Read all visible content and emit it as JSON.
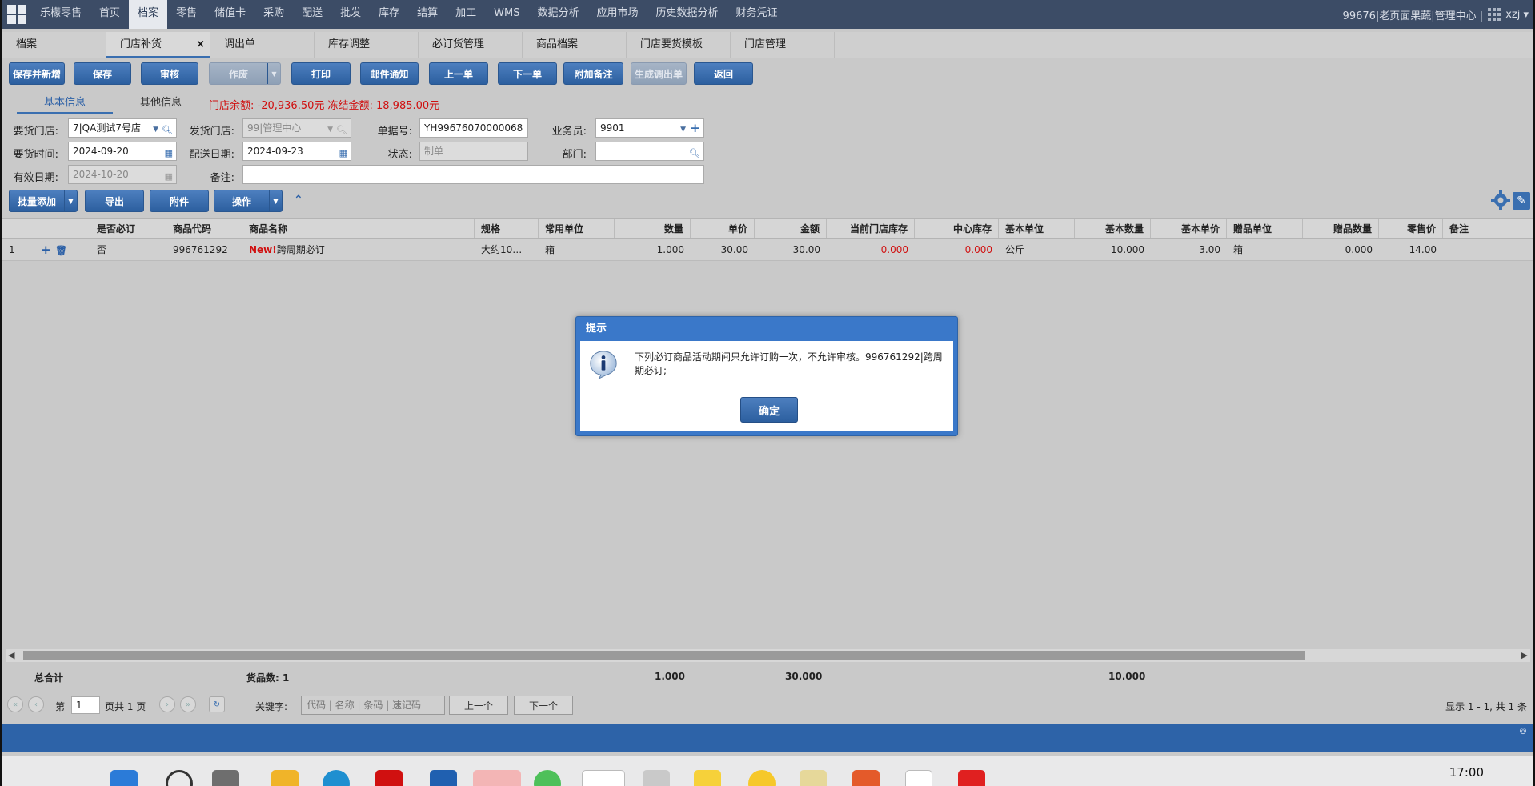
{
  "topnav": {
    "items": [
      "乐檬零售",
      "首页",
      "档案",
      "零售",
      "储值卡",
      "采购",
      "配送",
      "批发",
      "库存",
      "结算",
      "加工",
      "WMS",
      "数据分析",
      "应用市场",
      "历史数据分析",
      "财务凭证"
    ],
    "active_index": 2,
    "account": "99676|老页面果蔬|管理中心 |",
    "user": "xzj"
  },
  "tabs": [
    {
      "label": "档案"
    },
    {
      "label": "门店补货",
      "close": "×"
    },
    {
      "label": "调出单"
    },
    {
      "label": "库存调整"
    },
    {
      "label": "必订货管理"
    },
    {
      "label": "商品档案"
    },
    {
      "label": "门店要货模板"
    },
    {
      "label": "门店管理"
    }
  ],
  "toolbar": {
    "save_new": "保存并新增",
    "save": "保存",
    "audit": "审核",
    "void": "作废",
    "print": "打印",
    "email": "邮件通知",
    "prev": "上一单",
    "next": "下一单",
    "attach_note": "附加备注",
    "gen_out": "生成调出单",
    "back": "返回"
  },
  "subtabs": {
    "basic": "基本信息",
    "other": "其他信息"
  },
  "balance": {
    "text": "门店余额: -20,936.50元   冻结金额: 18,985.00元"
  },
  "form": {
    "req_store_label": "要货门店:",
    "req_store_value": "7|QA测试7号店",
    "ship_store_label": "发货门店:",
    "ship_store_value": "99|管理中心",
    "doc_no_label": "单据号:",
    "doc_no_value": "YH99676070000068",
    "salesman_label": "业务员:",
    "salesman_value": "9901",
    "req_time_label": "要货时间:",
    "req_time_value": "2024-09-20",
    "delivery_date_label": "配送日期:",
    "delivery_date_value": "2024-09-23",
    "status_label": "状态:",
    "status_value": "制单",
    "dept_label": "部门:",
    "dept_value": "",
    "valid_date_label": "有效日期:",
    "valid_date_value": "2024-10-20",
    "remark_label": "备注:",
    "remark_value": ""
  },
  "actions": {
    "batch_add": "批量添加",
    "export": "导出",
    "attachment": "附件",
    "operate": "操作"
  },
  "grid": {
    "headers": [
      "是否必订",
      "商品代码",
      "商品名称",
      "规格",
      "常用单位",
      "数量",
      "单价",
      "金额",
      "当前门店库存",
      "中心库存",
      "基本单位",
      "基本数量",
      "基本单价",
      "赠品单位",
      "赠品数量",
      "零售价",
      "备注"
    ],
    "rows": [
      {
        "no": "1",
        "required": "否",
        "code": "996761292",
        "new_tag": "New!",
        "name": "跨周期必订",
        "spec": "大约10…",
        "unit": "箱",
        "qty": "1.000",
        "price": "30.00",
        "amount": "30.00",
        "store_stock": "0.000",
        "center_stock": "0.000",
        "base_unit": "公斤",
        "base_qty": "10.000",
        "base_price": "3.00",
        "gift_unit": "箱",
        "gift_qty": "0.000",
        "retail_price": "14.00",
        "remark": ""
      }
    ]
  },
  "totals": {
    "label": "总合计",
    "count_label": "货品数: 1",
    "qty": "1.000",
    "amount": "30.000",
    "base_qty": "10.000"
  },
  "pager": {
    "page_prefix": "第",
    "page_value": "1",
    "page_suffix": "页共 1 页",
    "keyword_label": "关键字:",
    "keyword_placeholder": "代码 | 名称 | 条码 | 速记码",
    "prev": "上一个",
    "next": "下一个",
    "summary": "显示 1 - 1,  共 1 条"
  },
  "dialog": {
    "title": "提示",
    "message": "下列必订商品活动期间只允许订购一次，不允许审核。996761292|跨周期必订;",
    "ok": "确定"
  },
  "taskbar": {
    "clock": "17:00"
  },
  "colors": {
    "nav_bg": "#3c4c66",
    "accent": "#2d63a8",
    "alert_red": "#d01010"
  }
}
